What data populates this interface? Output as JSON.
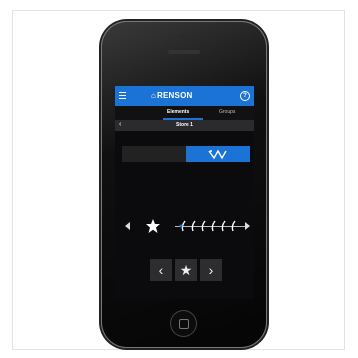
{
  "app": {
    "brand": "RENSON",
    "logo_mark": "⌂",
    "help_label": "?"
  },
  "tabs": [
    {
      "label": "Elements",
      "active": true
    },
    {
      "label": "Groups",
      "active": false
    }
  ],
  "group": {
    "name": "Store 1",
    "back_label": "‹"
  },
  "navigation": {
    "prev_label": "‹",
    "favorite_label": "★",
    "next_label": "›"
  },
  "colors": {
    "accent": "#1b73d6",
    "screen_background": "#0b0b0d",
    "button_background": "#2d2d2f"
  },
  "icons": [
    "menu-icon",
    "help-icon",
    "back-icon",
    "wave-icon",
    "star-icon",
    "slat-icon",
    "chevron-left-icon",
    "chevron-right-icon"
  ]
}
